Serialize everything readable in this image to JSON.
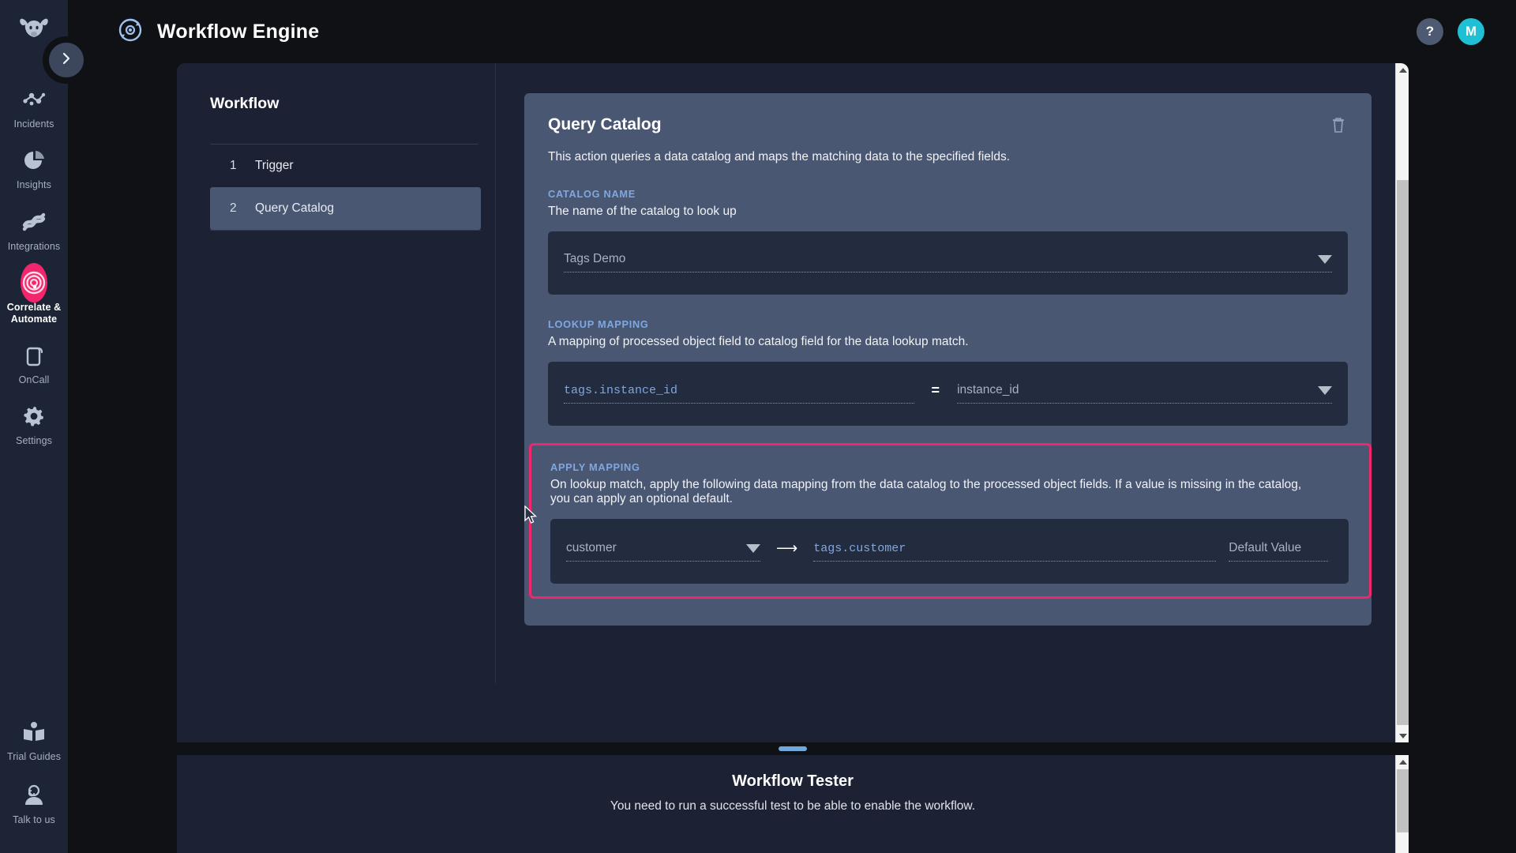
{
  "brand": {
    "logo_icon": "cow-logo-icon"
  },
  "sidebar": {
    "expand_icon": "chevron-right-icon",
    "items": [
      {
        "label": "Incidents",
        "icon": "incidents-nodes-icon",
        "active": false
      },
      {
        "label": "Insights",
        "icon": "pie-chart-icon",
        "active": false
      },
      {
        "label": "Integrations",
        "icon": "integrations-link-icon",
        "active": false
      },
      {
        "label": "Correlate & Automate",
        "icon": "correlate-target-icon",
        "active": true
      },
      {
        "label": "OnCall",
        "icon": "mobile-phone-icon",
        "active": false
      },
      {
        "label": "Settings",
        "icon": "gear-icon",
        "active": false
      }
    ],
    "bottom_items": [
      {
        "label": "Trial Guides",
        "icon": "open-book-icon"
      },
      {
        "label": "Talk to us",
        "icon": "support-agent-icon"
      }
    ],
    "accent_color": "#f2266c"
  },
  "header": {
    "title": "Workflow Engine",
    "app_icon": "workflow-refresh-icon",
    "help_label": "?",
    "avatar_label": "M",
    "avatar_color": "#1fbfd4"
  },
  "workflow": {
    "title": "Workflow",
    "steps": [
      {
        "number": "1",
        "label": "Trigger",
        "active": false
      },
      {
        "number": "2",
        "label": "Query Catalog",
        "active": true
      }
    ]
  },
  "action_card": {
    "title": "Query Catalog",
    "description": "This action queries a data catalog and maps the matching data to the specified fields.",
    "delete_icon": "trash-icon",
    "catalog_name": {
      "label": "CATALOG NAME",
      "help": "The name of the catalog to look up",
      "value": "Tags Demo",
      "dropdown_icon": "chevron-down-icon"
    },
    "lookup_mapping": {
      "label": "LOOKUP MAPPING",
      "help": "A mapping of processed object field to catalog field for the data lookup match.",
      "left_value": "tags.instance_id",
      "operator": "=",
      "right_value": "instance_id",
      "dropdown_icon": "chevron-down-icon"
    },
    "apply_mapping": {
      "label": "APPLY MAPPING",
      "help": "On lookup match, apply the following data mapping from the data catalog to the processed object fields. If a value is missing in the catalog, you can apply an optional default.",
      "source_value": "customer",
      "dropdown_icon": "chevron-down-icon",
      "arrow_icon": "arrow-right-icon",
      "target_value": "tags.customer",
      "default_placeholder": "Default Value",
      "highlight_color": "#f2266c"
    }
  },
  "tester": {
    "title": "Workflow Tester",
    "subtitle": "You need to run a successful test to be able to enable the workflow.",
    "grip_color": "#6fa8dc"
  },
  "scrollbars": {
    "up_icon": "scroll-up-arrow-icon",
    "down_icon": "scroll-down-arrow-icon"
  }
}
